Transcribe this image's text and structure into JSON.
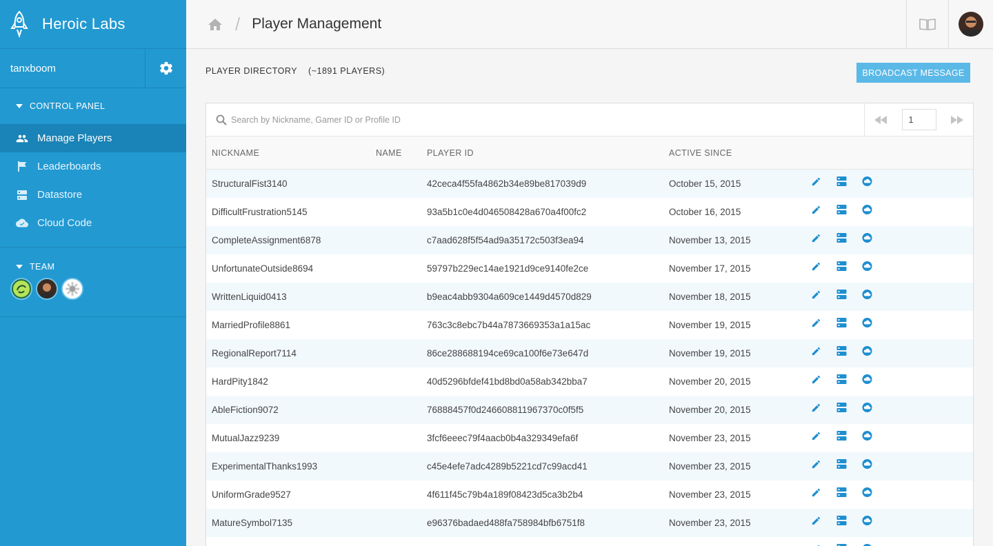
{
  "brand": {
    "name": "Heroic Labs"
  },
  "sidebar": {
    "username": "tanxboom",
    "control_panel_label": "CONTROL PANEL",
    "items": [
      {
        "label": "Manage Players",
        "icon": "people-icon",
        "active": true
      },
      {
        "label": "Leaderboards",
        "icon": "flag-icon",
        "active": false
      },
      {
        "label": "Datastore",
        "icon": "server-icon",
        "active": false
      },
      {
        "label": "Cloud Code",
        "icon": "cloud-icon",
        "active": false
      }
    ],
    "team_label": "TEAM"
  },
  "header": {
    "title": "Player Management"
  },
  "directory": {
    "title": "PLAYER DIRECTORY",
    "count": "(~1891 PLAYERS)",
    "broadcast_label": "BROADCAST MESSAGE"
  },
  "search": {
    "placeholder": "Search by Nickname, Gamer ID or Profile ID"
  },
  "pager": {
    "page": "1"
  },
  "table": {
    "columns": [
      "NICKNAME",
      "NAME",
      "PLAYER ID",
      "ACTIVE SINCE"
    ],
    "rows": [
      {
        "nickname": "StructuralFist3140",
        "name": "",
        "player_id": "42ceca4f55fa4862b34e89be817039d9",
        "active_since": "October 15, 2015"
      },
      {
        "nickname": "DifficultFrustration5145",
        "name": "",
        "player_id": "93a5b1c0e4d046508428a670a4f00fc2",
        "active_since": "October 16, 2015"
      },
      {
        "nickname": "CompleteAssignment6878",
        "name": "",
        "player_id": "c7aad628f5f54ad9a35172c503f3ea94",
        "active_since": "November 13, 2015"
      },
      {
        "nickname": "UnfortunateOutside8694",
        "name": "",
        "player_id": "59797b229ec14ae1921d9ce9140fe2ce",
        "active_since": "November 17, 2015"
      },
      {
        "nickname": "WrittenLiquid0413",
        "name": "",
        "player_id": "b9eac4abb9304a609ce1449d4570d829",
        "active_since": "November 18, 2015"
      },
      {
        "nickname": "MarriedProfile8861",
        "name": "",
        "player_id": "763c3c8ebc7b44a7873669353a1a15ac",
        "active_since": "November 19, 2015"
      },
      {
        "nickname": "RegionalReport7114",
        "name": "",
        "player_id": "86ce288688194ce69ca100f6e73e647d",
        "active_since": "November 19, 2015"
      },
      {
        "nickname": "HardPity1842",
        "name": "",
        "player_id": "40d5296bfdef41bd8bd0a58ab342bba7",
        "active_since": "November 20, 2015"
      },
      {
        "nickname": "AbleFiction9072",
        "name": "",
        "player_id": "76888457f0d246608811967370c0f5f5",
        "active_since": "November 20, 2015"
      },
      {
        "nickname": "MutualJazz9239",
        "name": "",
        "player_id": "3fcf6eeec79f4aacb0b4a329349efa6f",
        "active_since": "November 23, 2015"
      },
      {
        "nickname": "ExperimentalThanks1993",
        "name": "",
        "player_id": "c45e4efe7adc4289b5221cd7c99acd41",
        "active_since": "November 23, 2015"
      },
      {
        "nickname": "UniformGrade9527",
        "name": "",
        "player_id": "4f611f45c79b4a189f08423d5ca3b2b4",
        "active_since": "November 23, 2015"
      },
      {
        "nickname": "MatureSymbol7135",
        "name": "",
        "player_id": "e96376badaed488fa758984bfb6751f8",
        "active_since": "November 23, 2015"
      },
      {
        "nickname": "",
        "name": "",
        "player_id": "",
        "active_since": ""
      }
    ]
  },
  "colors": {
    "sidebar": "#2299d1",
    "sidebar_active": "#1a83b7",
    "accent": "#1e8fd0",
    "broadcast": "#5bb9e8"
  }
}
